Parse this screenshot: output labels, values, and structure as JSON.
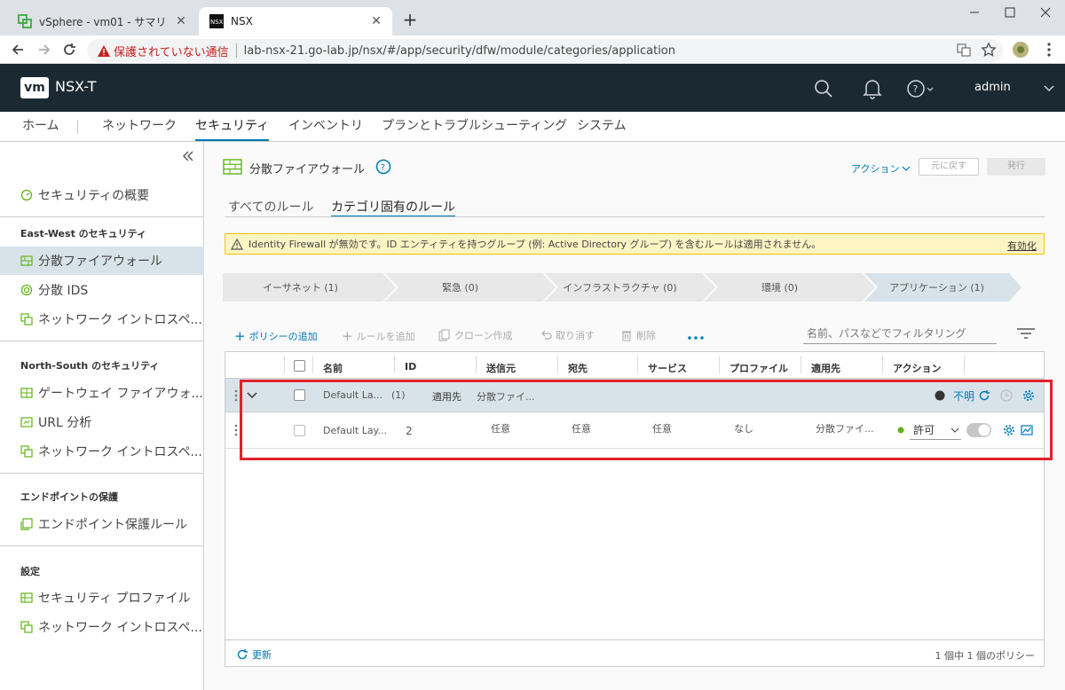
{
  "browser": {
    "tabs": [
      {
        "title": "vSphere - vm01 - サマリ"
      },
      {
        "title": "NSX"
      }
    ],
    "warning": "保護されていない通信",
    "url": "lab-nsx-21.go-lab.jp/nsx/#/app/security/dfw/module/categories/application"
  },
  "app": {
    "logo": "vm",
    "title": "NSX-T",
    "user": "admin"
  },
  "topnav": [
    "ホーム",
    "ネットワーク",
    "セキュリティ",
    "インベントリ",
    "プランとトラブルシューティング",
    "システム"
  ],
  "sidebar": {
    "overview": "セキュリティの概要",
    "sections": [
      {
        "header": "East-West のセキュリティ",
        "items": [
          "分散ファイアウォール",
          "分散 IDS",
          "ネットワーク イントロスペ..."
        ]
      },
      {
        "header": "North-South のセキュリティ",
        "items": [
          "ゲートウェイ ファイアウォ...",
          "URL 分析",
          "ネットワーク イントロスペ..."
        ]
      },
      {
        "header": "エンドポイントの保護",
        "items": [
          "エンドポイント保護ルール"
        ]
      },
      {
        "header": "設定",
        "items": [
          "セキュリティ プロファイル",
          "ネットワーク イントロスペ..."
        ]
      }
    ]
  },
  "page": {
    "title": "分散ファイアウォール",
    "actions_label": "アクション",
    "revert_label": "元に戻す",
    "publish_label": "発行",
    "tabs": [
      "すべてのルール",
      "カテゴリ固有のルール"
    ],
    "alert_text": "Identity Firewall が無効です。ID エンティティを持つグループ (例: Active Directory グループ) を含むルールは適用されません。",
    "alert_link": "有効化",
    "categories": [
      "イーサネット (1)",
      "緊急 (0)",
      "インフラストラクチャ (0)",
      "環境 (0)",
      "アプリケーション (1)"
    ],
    "toolbar": {
      "add_policy": "ポリシーの追加",
      "add_rule": "ルールを追加",
      "clone": "クローン作成",
      "undo": "取り消す",
      "delete": "削除",
      "filter_placeholder": "名前、パスなどでフィルタリング"
    },
    "columns": [
      "名前",
      "ID",
      "送信元",
      "宛先",
      "サービス",
      "プロファイル",
      "適用先",
      "アクション"
    ],
    "policy_row": {
      "name": "Default La...",
      "count": "(1)",
      "applied_label": "適用先",
      "applied_value": "分散ファイ...",
      "status": "不明"
    },
    "rule_row": {
      "name": "Default Lay...",
      "id": "2",
      "source": "任意",
      "destination": "任意",
      "service": "任意",
      "profile": "なし",
      "applied_to": "分散ファイ...",
      "action": "許可"
    },
    "refresh_label": "更新",
    "footer_count": "1 個中 1 個のポリシー"
  },
  "colors": {
    "accent": "#0079b8",
    "header_bg": "#1b2a32",
    "highlight_box": "#e0212b",
    "allow_dot": "#60b515"
  }
}
